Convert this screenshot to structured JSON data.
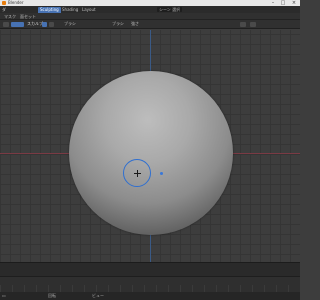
{
  "window": {
    "title": "Blender"
  },
  "menubar": {
    "items": [
      "ダ"
    ],
    "workspaces": [
      {
        "label": "Sculpting",
        "active": true
      },
      {
        "label": "Shading",
        "active": false
      },
      {
        "label": "Layout",
        "active": false
      }
    ],
    "scene_field": "シーン 選択"
  },
  "secondary": {
    "items": [
      "マスク",
      "面セット"
    ]
  },
  "toolbar": {
    "mode": "スカルプ",
    "items": [
      "ブラシ",
      "ブラシ",
      "強さ"
    ],
    "accent_color": "#4772b3"
  },
  "viewport": {
    "grid": true,
    "axis_colors": {
      "x": "#7a3a44",
      "y": "#3a5a86"
    },
    "brush_color": "#2f6fd0"
  },
  "footer": {
    "items": [
      "回転",
      "ビュー"
    ]
  }
}
